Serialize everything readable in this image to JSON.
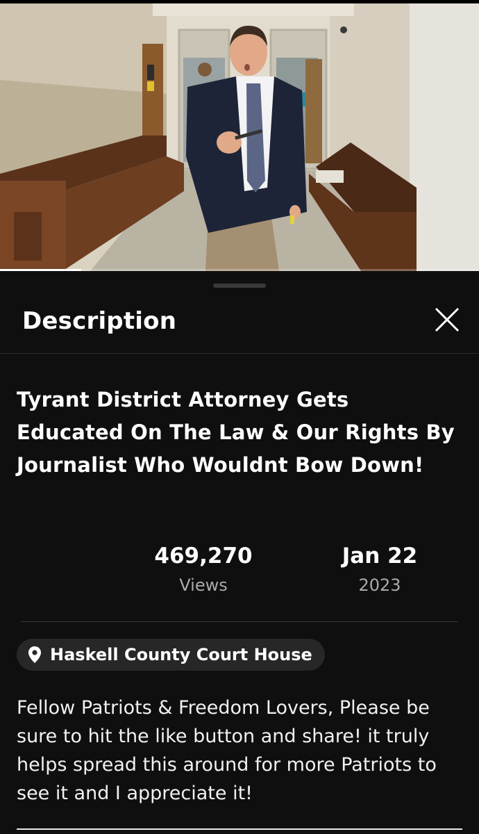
{
  "video": {
    "scene": "courthouse-hallway",
    "progress": 0.17
  },
  "sheet": {
    "title": "Description",
    "close_icon": "close-icon"
  },
  "video_info": {
    "title": "Tyrant District Attorney Gets Educated On The Law & Our Rights By Journalist Who Wouldnt Bow Down!",
    "views_value": "469,270",
    "views_label": "Views",
    "date_value": "Jan 22",
    "date_year": "2023",
    "location_icon": "location-pin-icon",
    "location": "Haskell County Court House",
    "description": "Fellow Patriots & Freedom Lovers, Please be sure to hit the like button and share! it truly helps spread this around for more Patriots to see it and I appreciate it!"
  }
}
